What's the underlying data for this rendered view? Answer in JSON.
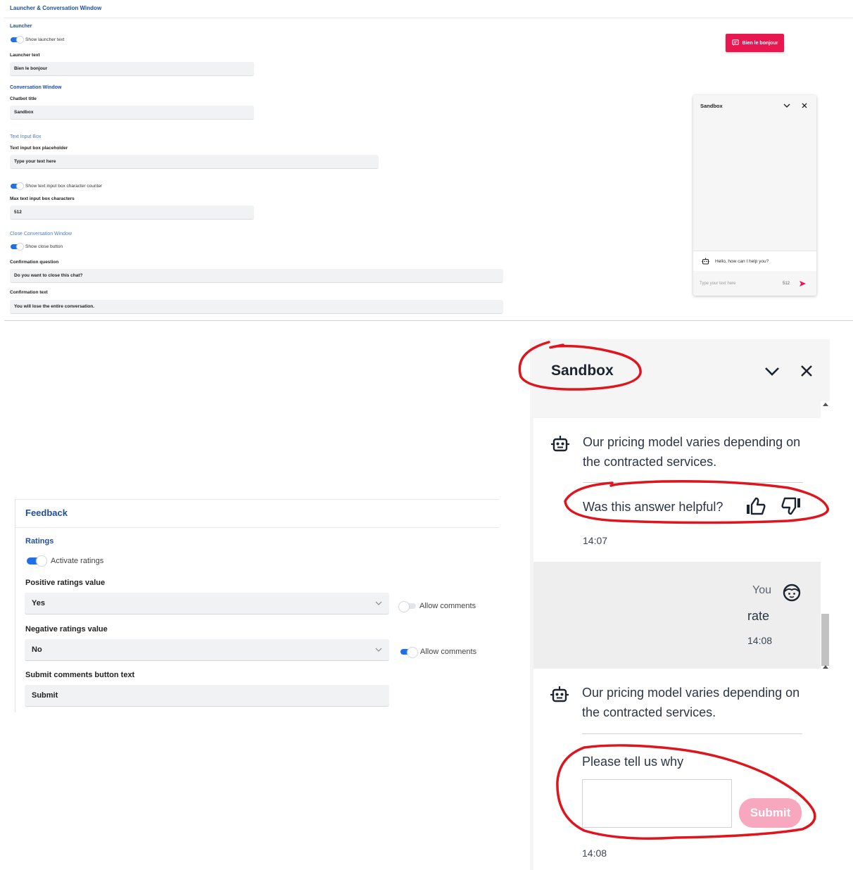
{
  "settings": {
    "header": "Launcher & Conversation Window",
    "launcher_section": "Launcher",
    "show_launcher_text": "Show launcher text",
    "launcher_text_label": "Launcher text",
    "launcher_text_value": "Bien le bonjour",
    "conversation_section": "Conversation Window",
    "chatbot_title_label": "Chatbot title",
    "chatbot_title_value": "Sandbox",
    "text_input_section": "Text Input Box",
    "placeholder_label": "Text input box placeholder",
    "placeholder_value": "Type your text here",
    "show_counter": "Show text input box character counter",
    "max_chars_label": "Max text input box characters",
    "max_chars_value": "512",
    "close_section": "Close Conversation Window",
    "show_close": "Show close button",
    "confirm_question_label": "Confirmation question",
    "confirm_question_value": "Do you want to close this chat?",
    "confirm_text_label": "Confirmation text",
    "confirm_text_value": "You will lose the entire conversation."
  },
  "preview": {
    "launcher_label": "Bien le bonjour",
    "title": "Sandbox",
    "greeting": "Hello, how can I help you?",
    "input_placeholder": "Type your text here",
    "counter": "512"
  },
  "feedback": {
    "title": "Feedback",
    "ratings_section": "Ratings",
    "activate_ratings": "Activate ratings",
    "positive_label": "Positive ratings value",
    "positive_value": "Yes",
    "positive_allow_comments": "Allow comments",
    "negative_label": "Negative ratings value",
    "negative_value": "No",
    "negative_allow_comments": "Allow comments",
    "submit_label": "Submit comments button text",
    "submit_value": "Submit"
  },
  "chat": {
    "title": "Sandbox",
    "bot_msg_1": "Our pricing model varies depending on the contracted services.",
    "helpful_question": "Was this answer helpful?",
    "time_1": "14:07",
    "user_name": "You",
    "user_msg": "rate",
    "time_2": "14:08",
    "bot_msg_2": "Our pricing model varies depending on the contracted services.",
    "why_prompt": "Please tell us why",
    "submit_button": "Submit",
    "time_3": "14:08"
  },
  "colors": {
    "accent_blue": "#1f6fe8",
    "brand_pink": "#e8174f",
    "annotation_red": "#e0141c"
  }
}
